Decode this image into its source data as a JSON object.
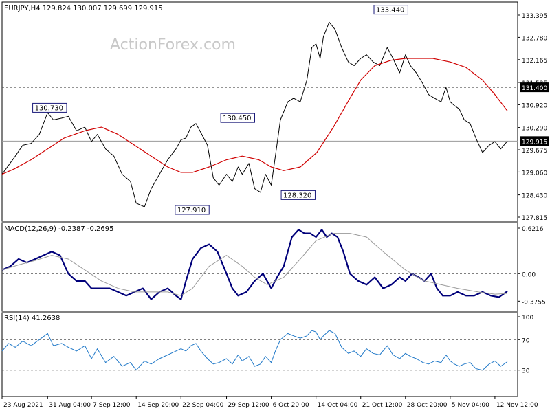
{
  "watermark": "ActionForex.com",
  "colors": {
    "price": "#000000",
    "ma": "#d00000",
    "macd": "#00007a",
    "signal": "#9a9a9a",
    "rsi": "#1f78c8",
    "label_border": "#1b1b7a",
    "grid": "#000000"
  },
  "chart_data": [
    {
      "type": "line",
      "title": "EURJPY,H4  129.824 130.007 129.699 129.915",
      "x_tick_labels": [
        "23 Aug 2021",
        "31 Aug 04:00",
        "7 Sep 12:00",
        "14 Sep 20:00",
        "22 Sep 04:00",
        "29 Sep 12:00",
        "6 Oct 20:00",
        "14 Oct 04:00",
        "21 Oct 12:00",
        "28 Oct 20:00",
        "5 Nov 04:00",
        "12 Nov 12:00"
      ],
      "x_tick_pos": [
        0,
        55,
        108,
        162,
        216,
        271,
        325,
        379,
        433,
        487,
        541,
        595
      ],
      "ylim": [
        127.815,
        133.395
      ],
      "y_ticks": [
        133.395,
        132.78,
        132.165,
        131.535,
        130.92,
        130.29,
        129.675,
        129.06,
        128.43,
        127.815
      ],
      "y_tick_labels": [
        "133.395",
        "132.780",
        "132.165",
        "131.535",
        "130.920",
        "130.290",
        "129.675",
        "129.060",
        "128.430",
        "127.815"
      ],
      "hlines": [
        {
          "value": 131.4,
          "label": "131.400",
          "style": "dashed"
        },
        {
          "value": 129.915,
          "label": "129.915",
          "style": "solid"
        }
      ],
      "annotations": [
        {
          "text": "130.730",
          "x": 78,
          "y": 130.73
        },
        {
          "text": "130.450",
          "x": 305,
          "y": 130.45
        },
        {
          "text": "133.440",
          "x": 490,
          "y": 133.44
        },
        {
          "text": "127.910",
          "x": 250,
          "y": 127.91
        },
        {
          "text": "128.320",
          "x": 378,
          "y": 128.32
        }
      ],
      "series": [
        {
          "x": [
            0,
            8,
            16,
            25,
            35,
            45,
            55,
            62,
            72,
            80,
            90,
            100,
            108,
            115,
            125,
            135,
            145,
            155,
            162,
            172,
            180,
            190,
            200,
            210,
            216,
            222,
            228,
            234,
            240,
            248,
            255,
            262,
            271,
            278,
            285,
            290,
            298,
            305,
            312,
            318,
            325,
            330,
            336,
            345,
            352,
            360,
            368,
            374,
            379,
            384,
            388,
            395,
            402,
            410,
            418,
            425,
            433,
            440,
            448,
            456,
            465,
            472,
            480,
            487,
            493,
            500,
            508,
            515,
            522,
            530,
            536,
            541,
            546,
            552,
            558,
            565,
            572,
            580,
            588,
            595,
            602,
            610
          ],
          "values": [
            129.0,
            129.25,
            129.5,
            129.8,
            129.85,
            130.1,
            130.7,
            130.5,
            130.55,
            130.6,
            130.2,
            130.3,
            129.9,
            130.1,
            129.7,
            129.5,
            129.0,
            128.8,
            128.2,
            128.1,
            128.6,
            129.0,
            129.4,
            129.7,
            129.95,
            130.0,
            130.3,
            130.4,
            130.15,
            129.8,
            128.9,
            128.7,
            129.0,
            128.8,
            129.2,
            129.0,
            129.3,
            128.6,
            128.5,
            129.0,
            128.7,
            129.5,
            130.5,
            131.0,
            131.1,
            131.0,
            131.6,
            132.5,
            132.6,
            132.2,
            132.8,
            133.2,
            133.0,
            132.5,
            132.1,
            132.0,
            132.2,
            132.3,
            132.1,
            132.0,
            132.5,
            132.2,
            131.8,
            132.3,
            132.0,
            131.8,
            131.5,
            131.2,
            131.1,
            131.0,
            131.4,
            131.0,
            130.9,
            130.8,
            130.5,
            130.4,
            130.0,
            129.6,
            129.8,
            129.9,
            129.7,
            129.915
          ]
        },
        {
          "x": [
            0,
            15,
            35,
            55,
            75,
            100,
            120,
            140,
            160,
            180,
            200,
            216,
            230,
            250,
            271,
            290,
            310,
            325,
            340,
            360,
            380,
            400,
            420,
            433,
            450,
            470,
            487,
            500,
            520,
            541,
            560,
            580,
            595,
            610
          ],
          "values": [
            129.0,
            129.15,
            129.4,
            129.7,
            130.0,
            130.2,
            130.3,
            130.1,
            129.8,
            129.5,
            129.2,
            129.05,
            129.05,
            129.2,
            129.4,
            129.5,
            129.4,
            129.2,
            129.1,
            129.2,
            129.6,
            130.3,
            131.1,
            131.6,
            132.0,
            132.15,
            132.2,
            132.2,
            132.2,
            132.1,
            131.95,
            131.6,
            131.2,
            130.75
          ]
        }
      ]
    },
    {
      "type": "line",
      "title": "MACD(12,26,9) -0.2387 -0.2695",
      "ylim": [
        -0.41,
        0.6216
      ],
      "y_ticks": [
        0.6216,
        0.0,
        -0.3755
      ],
      "y_tick_labels": [
        "0.6216",
        "0.00",
        "-0.3755"
      ],
      "hlines": [
        {
          "value": 0.0,
          "style": "dashed"
        }
      ],
      "series": [
        {
          "x": [
            0,
            10,
            20,
            30,
            40,
            50,
            60,
            70,
            80,
            90,
            100,
            108,
            120,
            130,
            140,
            150,
            160,
            170,
            180,
            190,
            200,
            210,
            216,
            222,
            230,
            240,
            250,
            260,
            271,
            278,
            285,
            295,
            305,
            315,
            325,
            332,
            340,
            350,
            358,
            365,
            372,
            379,
            386,
            392,
            398,
            405,
            412,
            420,
            430,
            440,
            450,
            460,
            470,
            480,
            487,
            495,
            503,
            510,
            518,
            525,
            532,
            541,
            550,
            560,
            570,
            580,
            590,
            600,
            610
          ],
          "values": [
            0.05,
            0.1,
            0.2,
            0.15,
            0.2,
            0.25,
            0.3,
            0.25,
            0.0,
            -0.1,
            -0.1,
            -0.2,
            -0.2,
            -0.2,
            -0.25,
            -0.3,
            -0.25,
            -0.2,
            -0.35,
            -0.25,
            -0.2,
            -0.3,
            -0.35,
            -0.1,
            0.2,
            0.35,
            0.4,
            0.3,
            0.0,
            -0.2,
            -0.3,
            -0.25,
            -0.1,
            0.0,
            -0.2,
            -0.05,
            0.1,
            0.5,
            0.6,
            0.55,
            0.55,
            0.5,
            0.6,
            0.5,
            0.55,
            0.5,
            0.3,
            0.0,
            -0.1,
            -0.15,
            -0.05,
            -0.2,
            -0.15,
            -0.05,
            -0.1,
            0.0,
            -0.05,
            -0.1,
            0.0,
            -0.2,
            -0.3,
            -0.3,
            -0.25,
            -0.3,
            -0.3,
            -0.25,
            -0.3,
            -0.32,
            -0.24
          ]
        },
        {
          "x": [
            0,
            20,
            40,
            60,
            80,
            100,
            120,
            140,
            160,
            180,
            200,
            216,
            230,
            250,
            271,
            290,
            305,
            320,
            340,
            360,
            379,
            400,
            420,
            440,
            460,
            487,
            510,
            530,
            550,
            575,
            595,
            610
          ],
          "values": [
            0.05,
            0.12,
            0.18,
            0.25,
            0.2,
            0.05,
            -0.1,
            -0.2,
            -0.25,
            -0.25,
            -0.25,
            -0.3,
            -0.2,
            0.1,
            0.25,
            0.1,
            -0.05,
            -0.15,
            -0.05,
            0.2,
            0.45,
            0.55,
            0.55,
            0.5,
            0.3,
            0.05,
            -0.1,
            -0.15,
            -0.2,
            -0.25,
            -0.28,
            -0.27
          ]
        }
      ]
    },
    {
      "type": "line",
      "title": "RSI(14) 41.2638",
      "ylim": [
        0,
        100
      ],
      "y_ticks": [
        100,
        70,
        30
      ],
      "y_tick_labels": [
        "100",
        "70",
        "30"
      ],
      "hlines": [
        {
          "value": 70,
          "style": "dashed"
        },
        {
          "value": 30,
          "style": "dashed"
        }
      ],
      "series": [
        {
          "x": [
            0,
            8,
            16,
            25,
            35,
            45,
            55,
            62,
            72,
            80,
            90,
            100,
            108,
            115,
            125,
            135,
            145,
            155,
            162,
            172,
            180,
            190,
            200,
            210,
            216,
            222,
            228,
            234,
            240,
            248,
            255,
            262,
            271,
            278,
            285,
            290,
            298,
            305,
            312,
            318,
            325,
            330,
            336,
            345,
            352,
            360,
            368,
            374,
            379,
            384,
            388,
            395,
            402,
            410,
            418,
            425,
            433,
            440,
            448,
            456,
            465,
            472,
            480,
            487,
            493,
            500,
            508,
            515,
            522,
            530,
            536,
            541,
            546,
            552,
            558,
            565,
            572,
            580,
            588,
            595,
            602,
            610
          ],
          "values": [
            55,
            65,
            60,
            68,
            62,
            70,
            78,
            62,
            65,
            60,
            55,
            62,
            45,
            58,
            40,
            48,
            35,
            40,
            30,
            42,
            38,
            45,
            50,
            55,
            58,
            55,
            62,
            65,
            55,
            45,
            38,
            40,
            45,
            38,
            50,
            42,
            48,
            35,
            38,
            48,
            40,
            55,
            70,
            78,
            75,
            72,
            75,
            82,
            80,
            70,
            75,
            82,
            78,
            60,
            52,
            55,
            48,
            58,
            52,
            50,
            62,
            50,
            45,
            52,
            48,
            45,
            40,
            38,
            42,
            40,
            50,
            42,
            38,
            35,
            38,
            40,
            32,
            30,
            38,
            42,
            35,
            41
          ]
        }
      ]
    }
  ]
}
